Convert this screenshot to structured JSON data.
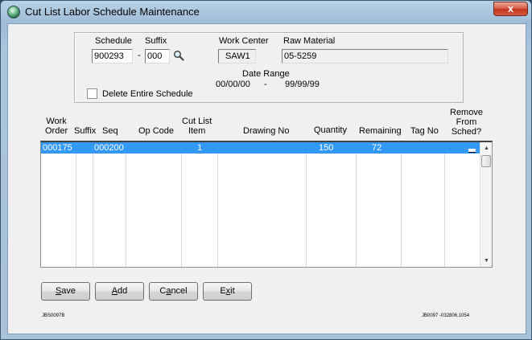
{
  "window": {
    "title": "Cut List Labor Schedule Maintenance",
    "close_glyph": "x"
  },
  "header": {
    "schedule_label": "Schedule",
    "schedule_value": "900293",
    "dash": "-",
    "suffix_label": "Suffix",
    "suffix_value": "000",
    "search_icon": "search-icon",
    "work_center_label": "Work Center",
    "work_center_value": "SAW1",
    "raw_material_label": "Raw Material",
    "raw_material_value": "05-5259",
    "date_range_label": "Date Range",
    "date_from": "00/00/00",
    "date_sep": "-",
    "date_to": "99/99/99",
    "delete_label": "Delete Entire Schedule",
    "delete_checked": false
  },
  "grid": {
    "columns": {
      "work_order": [
        "Work",
        "Order"
      ],
      "suffix": "Suffix",
      "seq": "Seq",
      "op_code": "Op Code",
      "cut_list_item": [
        "Cut List",
        "Item"
      ],
      "drawing_no": "Drawing No",
      "quantity": "Quantity",
      "remaining": "Remaining",
      "tag_no": "Tag No",
      "remove": [
        "Remove",
        "From",
        "Sched?"
      ]
    },
    "rows": [
      {
        "work_order": "000175",
        "suffix": "",
        "seq": "000200",
        "op_code": "",
        "cut_list_item": "1",
        "drawing_no": "",
        "quantity": "150",
        "remaining": "72",
        "tag_no": "",
        "remove": "",
        "selected": true
      }
    ]
  },
  "buttons": {
    "save": {
      "hot": "S",
      "rest": "ave"
    },
    "add": {
      "hot": "A",
      "rest": "dd"
    },
    "cancel": {
      "pre": "C",
      "hot": "a",
      "rest": "ncel"
    },
    "exit": {
      "pre": "E",
      "hot": "x",
      "rest": "it"
    }
  },
  "footer": {
    "left_code": "JBS0097B",
    "right_code": "JB0097 -032806.1054"
  },
  "colors": {
    "selection": "#3399ff",
    "title_bar": "#9fbbd6",
    "close_button": "#c2331c"
  }
}
